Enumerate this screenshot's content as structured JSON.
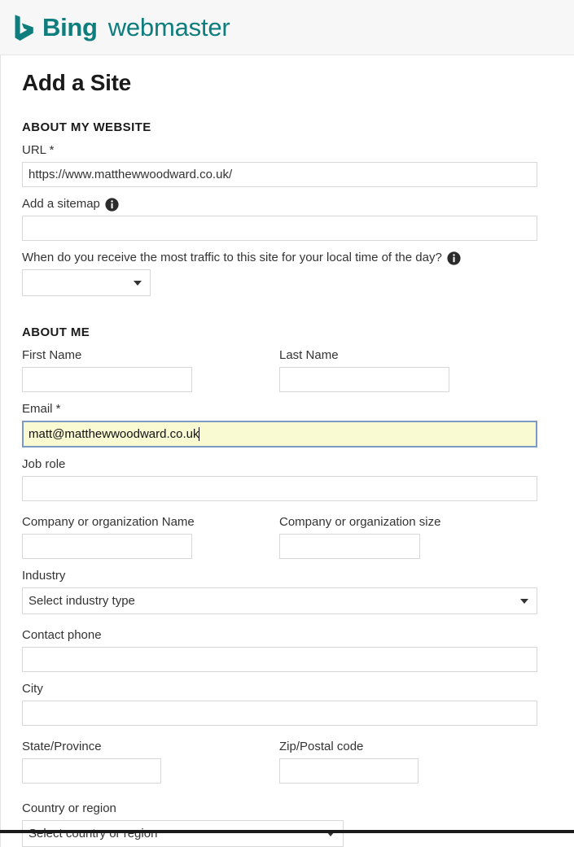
{
  "header": {
    "brand_name": "Bing",
    "brand_sub": "webmaster",
    "brand_color": "#0d7d7d",
    "logo_icon": "bing-b-logo-icon"
  },
  "page": {
    "title": "Add a Site"
  },
  "sections": {
    "website": {
      "heading": "ABOUT MY WEBSITE",
      "url": {
        "label": "URL *",
        "value": "https://www.matthewwoodward.co.uk/",
        "placeholder": ""
      },
      "sitemap": {
        "label": "Add a sitemap",
        "value": "",
        "placeholder": "",
        "info_icon": "info-icon"
      },
      "traffic": {
        "label": "When do you receive the most traffic to this site for your local time of the day?",
        "info_icon": "info-icon",
        "selected": "",
        "options": []
      }
    },
    "about_me": {
      "heading": "ABOUT ME",
      "first_name": {
        "label": "First Name",
        "value": "",
        "placeholder": ""
      },
      "last_name": {
        "label": "Last Name",
        "value": "",
        "placeholder": ""
      },
      "email": {
        "label": "Email *",
        "value": "matt@matthewwoodward.co.uk",
        "placeholder": "",
        "autofilled": true,
        "autofill_bg": "#fafad2",
        "focus_border": "#7a9ac4"
      },
      "job_role": {
        "label": "Job role",
        "value": "",
        "placeholder": ""
      },
      "company_name": {
        "label": "Company or organization Name",
        "value": "",
        "placeholder": ""
      },
      "company_size": {
        "label": "Company or organization size",
        "value": "",
        "placeholder": ""
      },
      "industry": {
        "label": "Industry",
        "selected": "Select industry type",
        "options": [
          "Select industry type"
        ]
      },
      "contact_phone": {
        "label": "Contact phone",
        "value": "",
        "placeholder": ""
      },
      "city": {
        "label": "City",
        "value": "",
        "placeholder": ""
      },
      "state": {
        "label": "State/Province",
        "value": "",
        "placeholder": ""
      },
      "zip": {
        "label": "Zip/Postal code",
        "value": "",
        "placeholder": ""
      },
      "country": {
        "label": "Country or region",
        "selected": "Select country or region",
        "options": [
          "Select country or region"
        ]
      }
    }
  }
}
